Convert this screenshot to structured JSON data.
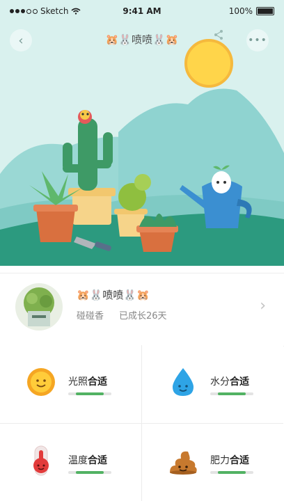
{
  "status_bar": {
    "carrier": "Sketch",
    "time": "9:41 AM",
    "battery": "100%"
  },
  "nav": {
    "title": "🐹🐰喷喷🐰🐹"
  },
  "profile": {
    "name": "🐹🐰喷喷🐰🐹",
    "species": "碰碰香",
    "age": "已成长26天"
  },
  "stats": [
    {
      "name": "光照",
      "status": "合适",
      "level": 0.65,
      "icon": "sun-icon"
    },
    {
      "name": "水分",
      "status": "合适",
      "level": 0.65,
      "icon": "water-drop-icon"
    },
    {
      "name": "温度",
      "status": "合适",
      "level": 0.65,
      "icon": "thermometer-icon"
    },
    {
      "name": "肥力",
      "status": "合适",
      "level": 0.65,
      "icon": "fertilizer-icon"
    }
  ],
  "colors": {
    "sky": "#d9f1ee",
    "hill": "#8fd3d0",
    "ground": "#2c9a7f",
    "accent_green": "#52b263",
    "sun": "#ffd54a"
  }
}
